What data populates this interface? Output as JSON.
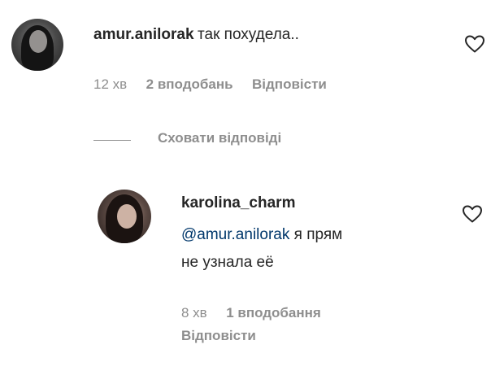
{
  "comment": {
    "username": "amur.anilorak",
    "text": "так похудела..",
    "time": "12 хв",
    "likes": "2 вподобань",
    "reply_label": "Відповісти"
  },
  "replies_toggle": {
    "label": "Сховати відповіді"
  },
  "reply": {
    "username": "karolina_charm",
    "mention": "@amur.anilorak",
    "text_line1": " я прям",
    "text_line2": "не узнала её",
    "time": "8 хв",
    "likes": "1 вподобання",
    "reply_label": "Відповісти"
  },
  "icons": {
    "like": "heart-outline-icon"
  }
}
